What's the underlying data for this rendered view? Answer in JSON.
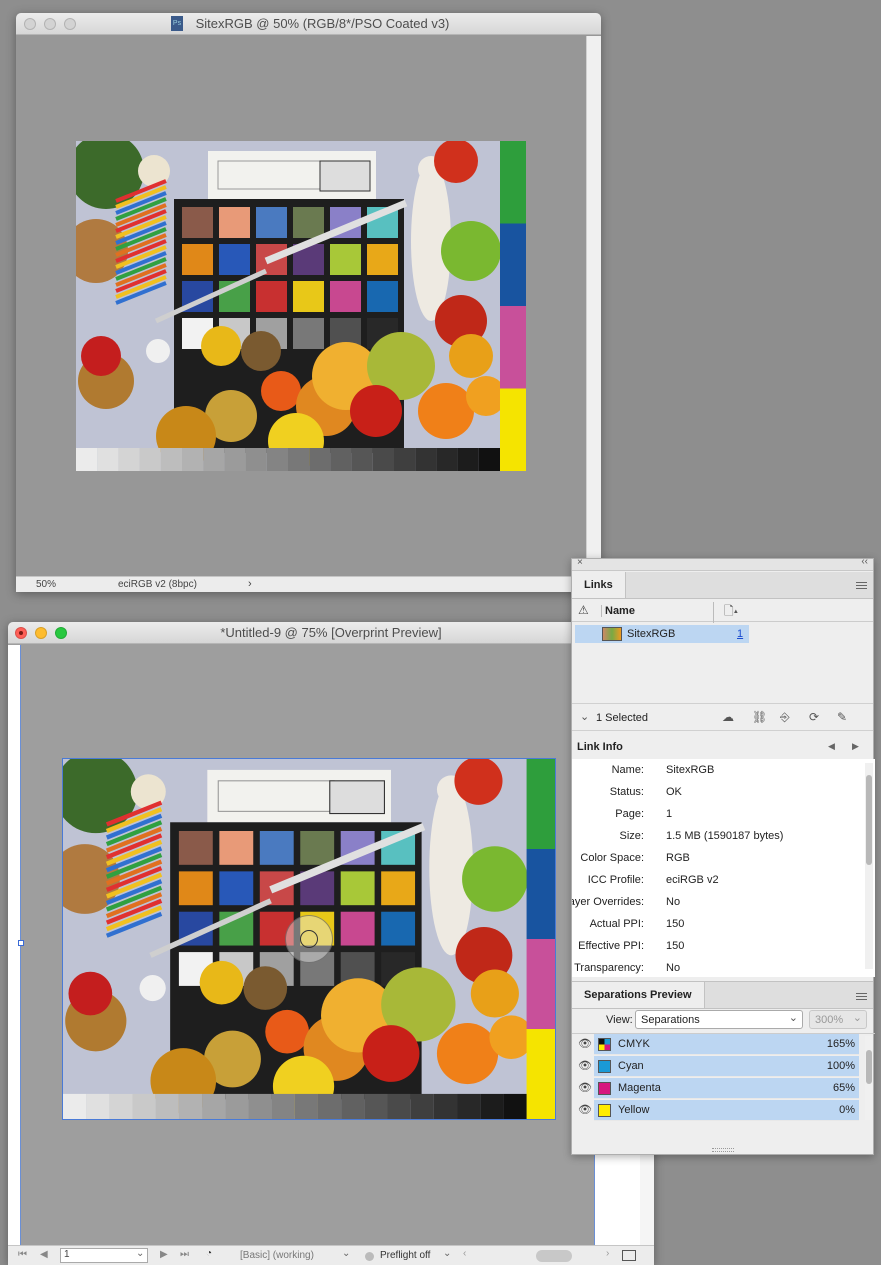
{
  "window1": {
    "title": "SitexRGB @ 50% (RGB/8*/PSO Coated v3)",
    "zoom": "50%",
    "profile": "eciRGB v2 (8bpc)",
    "ps_badge": "Ps"
  },
  "window2": {
    "title": "*Untitled-9 @ 75% [Overprint Preview]",
    "page": "1",
    "style": "[Basic] (working)",
    "preflight": "Preflight off"
  },
  "colors": {
    "patch_colors": [
      "#8a5a4a",
      "#e89a78",
      "#4a7ac0",
      "#6a7a50",
      "#8a80c8",
      "#58c0c0",
      "#e08818",
      "#2858b8",
      "#c84848",
      "#5a3a78",
      "#a8c838",
      "#e8a818",
      "#2848a0",
      "#48a048",
      "#c83030",
      "#e8c818",
      "#c84890",
      "#1868b0",
      "#f2f2f2",
      "#c8c8c8",
      "#a0a0a0",
      "#787878",
      "#505050",
      "#282828"
    ],
    "side_bars": [
      "#2e9e3c",
      "#1854a0",
      "#c8509a",
      "#f5e400"
    ]
  },
  "links_panel": {
    "tab": "Links",
    "col_name": "Name",
    "rows": [
      {
        "name": "SitexRGB",
        "page": "1"
      }
    ],
    "selected": "1 Selected",
    "link_info_title": "Link Info",
    "info": [
      {
        "k": "Name:",
        "v": "SitexRGB"
      },
      {
        "k": "Status:",
        "v": "OK"
      },
      {
        "k": "Page:",
        "v": "1"
      },
      {
        "k": "Size:",
        "v": "1.5 MB (1590187 bytes)"
      },
      {
        "k": "Color Space:",
        "v": "RGB"
      },
      {
        "k": "ICC Profile:",
        "v": "eciRGB v2"
      },
      {
        "k": "Layer Overrides:",
        "v": "No"
      },
      {
        "k": "Actual PPI:",
        "v": "150"
      },
      {
        "k": "Effective PPI:",
        "v": "150"
      },
      {
        "k": "Transparency:",
        "v": "No"
      }
    ]
  },
  "separations": {
    "tab": "Separations Preview",
    "view_label": "View:",
    "view_value": "Separations",
    "zoom": "300%",
    "items": [
      {
        "name": "CMYK",
        "pct": "165%",
        "color": "#ffffff"
      },
      {
        "name": "Cyan",
        "pct": "100%",
        "color": "#1a9ad6"
      },
      {
        "name": "Magenta",
        "pct": "65%",
        "color": "#d6177e"
      },
      {
        "name": "Yellow",
        "pct": "0%",
        "color": "#ffec00"
      }
    ]
  }
}
